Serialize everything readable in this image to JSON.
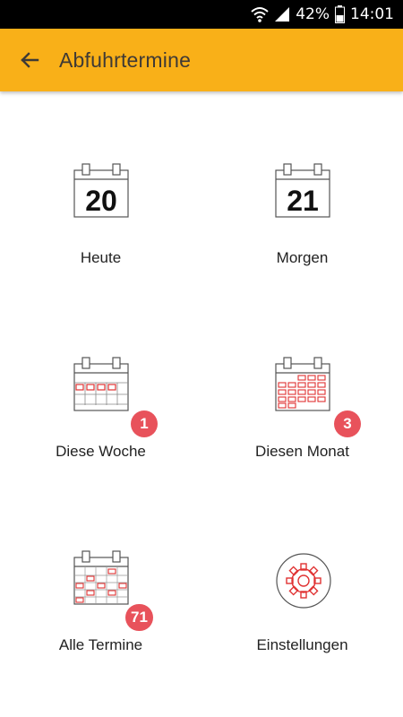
{
  "status_bar": {
    "battery": "42%",
    "time": "14:01",
    "icons": [
      "wifi-icon",
      "signal-icon",
      "battery-icon"
    ]
  },
  "app_bar": {
    "title": "Abfuhrtermine",
    "back_icon": "arrow-left-icon"
  },
  "menu": {
    "today": {
      "label": "Heute",
      "day": "20",
      "icon": "calendar-day-icon"
    },
    "tomorrow": {
      "label": "Morgen",
      "day": "21",
      "icon": "calendar-day-icon"
    },
    "this_week": {
      "label": "Diese Woche",
      "badge": "1",
      "icon": "calendar-week-icon"
    },
    "this_month": {
      "label": "Diesen Monat",
      "badge": "3",
      "icon": "calendar-month-icon"
    },
    "all_dates": {
      "label": "Alle Termine",
      "badge": "71",
      "icon": "calendar-all-icon"
    },
    "settings": {
      "label": "Einstellungen",
      "icon": "gear-icon"
    }
  },
  "colors": {
    "app_bar": "#f9b018",
    "badge": "#e8525b",
    "icon_accent": "#e03232",
    "icon_line": "#555555"
  }
}
